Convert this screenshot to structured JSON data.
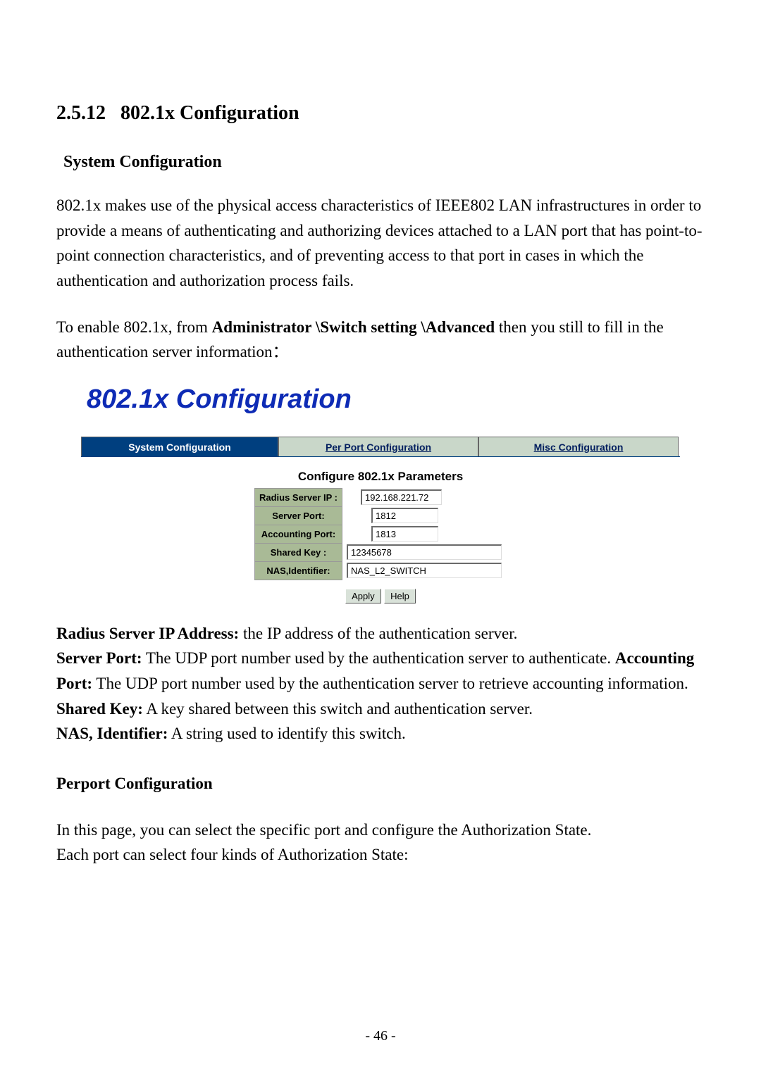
{
  "section_number": "2.5.12",
  "section_title": "802.1x Configuration",
  "subheading1": "System Configuration",
  "para1": "802.1x makes use of the physical access characteristics of IEEE802 LAN infrastructures in order to provide a means of authenticating and authorizing devices attached to a LAN port that has point-to-point connection characteristics, and of preventing access to that port in cases in which the authentication and authorization process fails.",
  "para2_prefix": "To enable 802.1x, from ",
  "para2_bold": "Administrator \\Switch setting \\Advanced",
  "para2_suffix": " then you still to fill in the authentication server information：",
  "screenshot": {
    "title": "802.1x Configuration",
    "tabs": {
      "active": "System Configuration",
      "per_port": "Per Port Configuration",
      "misc": "Misc Configuration"
    },
    "body_title": "Configure 802.1x Parameters",
    "rows": {
      "radius_ip": {
        "label": "Radius Server IP :",
        "value": "192.168.221.72"
      },
      "server_port": {
        "label": "Server Port:",
        "value": "1812"
      },
      "accounting_port": {
        "label": "Accounting Port:",
        "value": "1813"
      },
      "shared_key": {
        "label": "Shared Key :",
        "value": "12345678"
      },
      "nas": {
        "label": "NAS,Identifier:",
        "value": "NAS_L2_SWITCH"
      }
    },
    "buttons": {
      "apply": "Apply",
      "help": "Help"
    }
  },
  "descriptions": {
    "radius": {
      "label": "Radius Server IP Address:",
      "text": " the IP address of the authentication server."
    },
    "server_port": {
      "label": "Server Port:",
      "text": " The UDP port number used by the authentication server to authenticate. "
    },
    "accounting": {
      "label": "Accounting Port:",
      "text": " The UDP port number used by the authentication server to retrieve accounting information."
    },
    "shared": {
      "label": "Shared Key:",
      "text": " A key shared between this switch and authentication server."
    },
    "nas": {
      "label": "NAS, Identifier:",
      "text": " A string used to identify this switch."
    }
  },
  "subheading2": "Perport Configuration",
  "para3": "In this page, you can select the specific port and configure the Authorization State.",
  "para4": "Each port can select four kinds of Authorization State:",
  "page_number": "- 46 -"
}
